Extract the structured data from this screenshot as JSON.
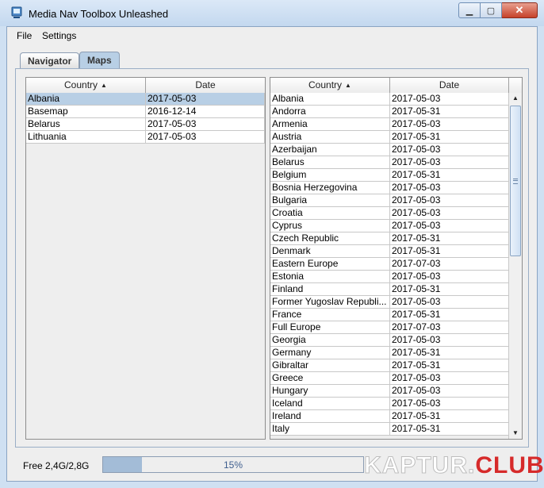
{
  "window": {
    "title": "Media Nav Toolbox Unleashed",
    "buttons": {
      "minimize": "▁",
      "maximize": "▢",
      "close": "✕"
    }
  },
  "menu": [
    "File",
    "Settings"
  ],
  "tabs": [
    {
      "label": "Navigator",
      "active": false
    },
    {
      "label": "Maps",
      "active": true
    }
  ],
  "left_table": {
    "columns": [
      "Country",
      "Date"
    ],
    "sort_icon": "▲",
    "rows": [
      [
        "Albania",
        "2017-05-03"
      ],
      [
        "Basemap",
        "2016-12-14"
      ],
      [
        "Belarus",
        "2017-05-03"
      ],
      [
        "Lithuania",
        "2017-05-03"
      ]
    ],
    "selected_row": 0
  },
  "right_table": {
    "columns": [
      "Country",
      "Date"
    ],
    "sort_icon": "▲",
    "rows": [
      [
        "Albania",
        "2017-05-03"
      ],
      [
        "Andorra",
        "2017-05-31"
      ],
      [
        "Armenia",
        "2017-05-03"
      ],
      [
        "Austria",
        "2017-05-31"
      ],
      [
        "Azerbaijan",
        "2017-05-03"
      ],
      [
        "Belarus",
        "2017-05-03"
      ],
      [
        "Belgium",
        "2017-05-31"
      ],
      [
        "Bosnia Herzegovina",
        "2017-05-03"
      ],
      [
        "Bulgaria",
        "2017-05-03"
      ],
      [
        "Croatia",
        "2017-05-03"
      ],
      [
        "Cyprus",
        "2017-05-03"
      ],
      [
        "Czech Republic",
        "2017-05-31"
      ],
      [
        "Denmark",
        "2017-05-31"
      ],
      [
        "Eastern Europe",
        "2017-07-03"
      ],
      [
        "Estonia",
        "2017-05-03"
      ],
      [
        "Finland",
        "2017-05-31"
      ],
      [
        "Former Yugoslav Republi...",
        "2017-05-03"
      ],
      [
        "France",
        "2017-05-31"
      ],
      [
        "Full Europe",
        "2017-07-03"
      ],
      [
        "Georgia",
        "2017-05-03"
      ],
      [
        "Germany",
        "2017-05-31"
      ],
      [
        "Gibraltar",
        "2017-05-31"
      ],
      [
        "Greece",
        "2017-05-03"
      ],
      [
        "Hungary",
        "2017-05-03"
      ],
      [
        "Iceland",
        "2017-05-03"
      ],
      [
        "Ireland",
        "2017-05-31"
      ],
      [
        "Italy",
        "2017-05-31"
      ]
    ]
  },
  "scrollbar": {
    "up_icon": "▲",
    "down_icon": "▼"
  },
  "status": {
    "free_label": "Free 2,4G/2,8G",
    "progress_text": "15%",
    "progress": 0.15
  },
  "watermark": {
    "part1": "KAPTUR.",
    "part2": "CLUB"
  },
  "colors": {
    "selection": "#b8cfe5",
    "progress_fill": "#a3bcd7",
    "watermark_red": "#d62a2a"
  }
}
